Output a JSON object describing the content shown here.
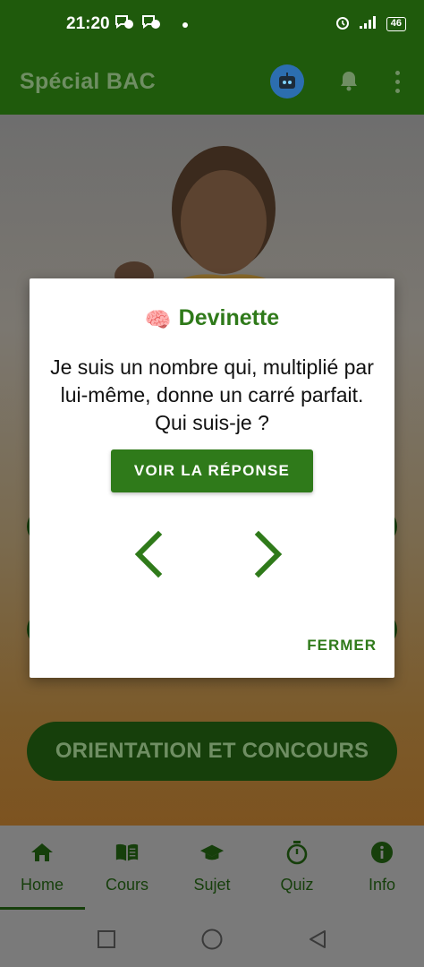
{
  "status_bar": {
    "time": "21:20",
    "battery": "46",
    "left_icons": [
      "chat-notification-icon",
      "chat-notification-icon"
    ],
    "right_icons": [
      "alarm-icon",
      "signal-icon",
      "battery-icon"
    ]
  },
  "app_bar": {
    "title": "Spécial BAC",
    "icons": [
      "robot-icon",
      "bell-icon",
      "more-vert-icon"
    ]
  },
  "home": {
    "orientation_button": "ORIENTATION ET CONCOURS"
  },
  "dialog": {
    "emoji": "🧠",
    "title": "Devinette",
    "question": "Je suis un nombre qui, multiplié par lui-même, donne un carré parfait. Qui suis-je ?",
    "reveal_label": "VOIR LA RÉPONSE",
    "close_label": "FERMER"
  },
  "bottom_nav": {
    "items": [
      {
        "label": "Home",
        "icon": "home-icon",
        "selected": true
      },
      {
        "label": "Cours",
        "icon": "book-icon",
        "selected": false
      },
      {
        "label": "Sujet",
        "icon": "graduation-cap-icon",
        "selected": false
      },
      {
        "label": "Quiz",
        "icon": "stopwatch-icon",
        "selected": false
      },
      {
        "label": "Info",
        "icon": "info-icon",
        "selected": false
      }
    ]
  },
  "colors": {
    "primary_dark": "#1f5a0c",
    "accent_green": "#2f7a1a",
    "scrim_nav": "#7a7a7a"
  }
}
